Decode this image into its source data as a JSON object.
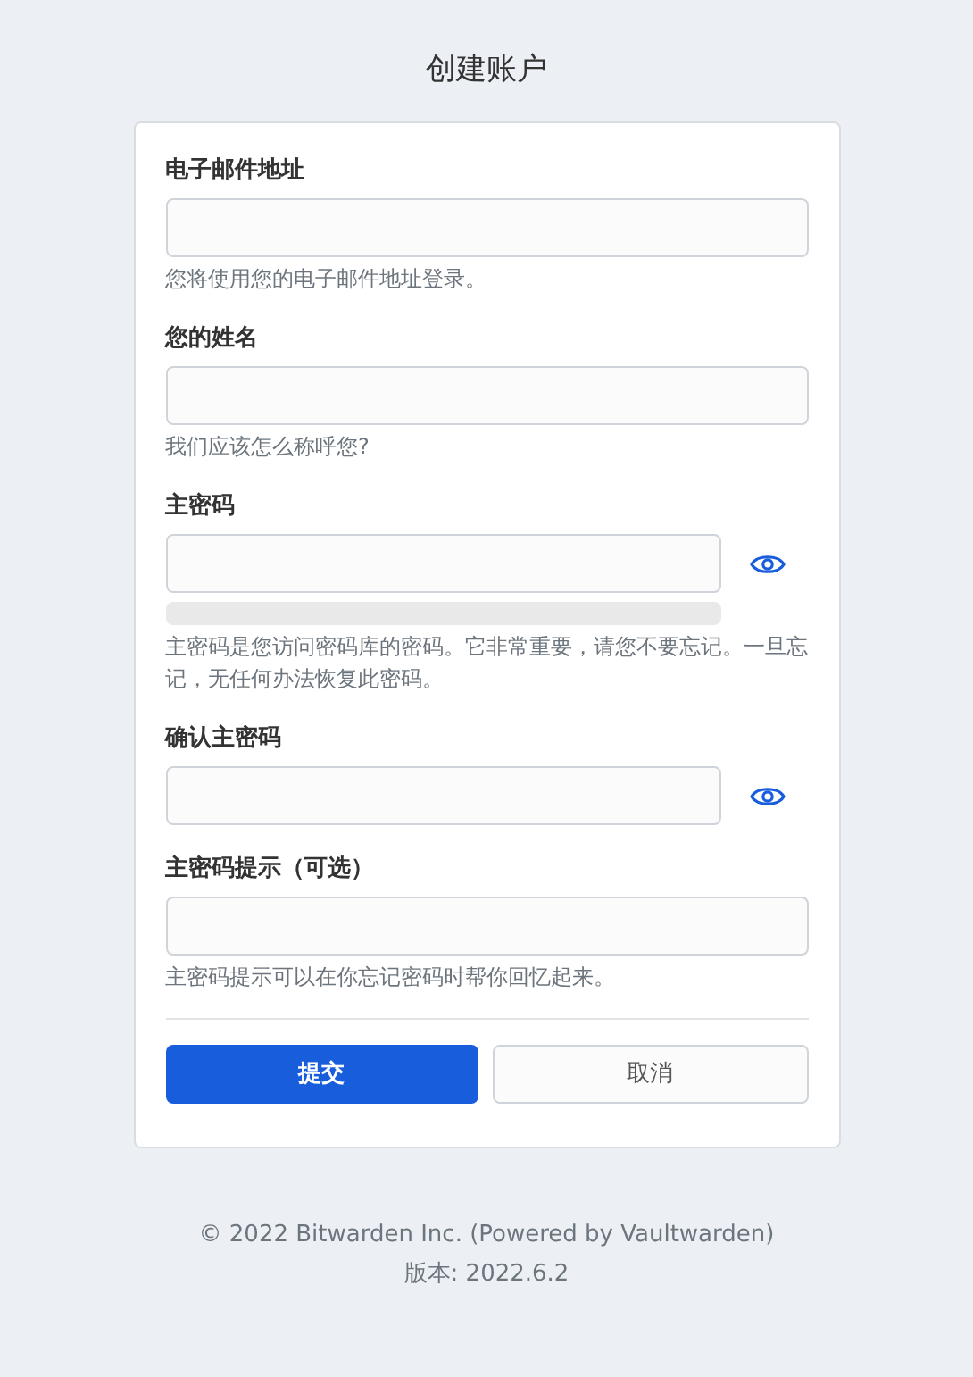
{
  "title": "创建账户",
  "fields": [
    {
      "kind": "text",
      "label": "电子邮件地址",
      "hint": "您将使用您的电子邮件地址登录。"
    },
    {
      "kind": "text",
      "label": "您的姓名",
      "hint": "我们应该怎么称呼您?"
    },
    {
      "kind": "password",
      "label": "主密码",
      "strength": {
        "level": 0
      },
      "hint": "主密码是您访问密码库的密码。它非常重要，请您不要忘记。一旦忘记，无任何办法恢复此密码。"
    },
    {
      "kind": "password",
      "label": "确认主密码"
    },
    {
      "kind": "text",
      "label": "主密码提示（可选）",
      "hint": "主密码提示可以在你忘记密码时帮你回忆起来。"
    }
  ],
  "buttons": [
    {
      "label": "提交",
      "kind": "primary"
    },
    {
      "label": "取消",
      "kind": "secondary"
    }
  ],
  "footer": [
    "© 2022 Bitwarden Inc. (Powered by Vaultwarden)",
    "版本: 2022.6.2"
  ]
}
